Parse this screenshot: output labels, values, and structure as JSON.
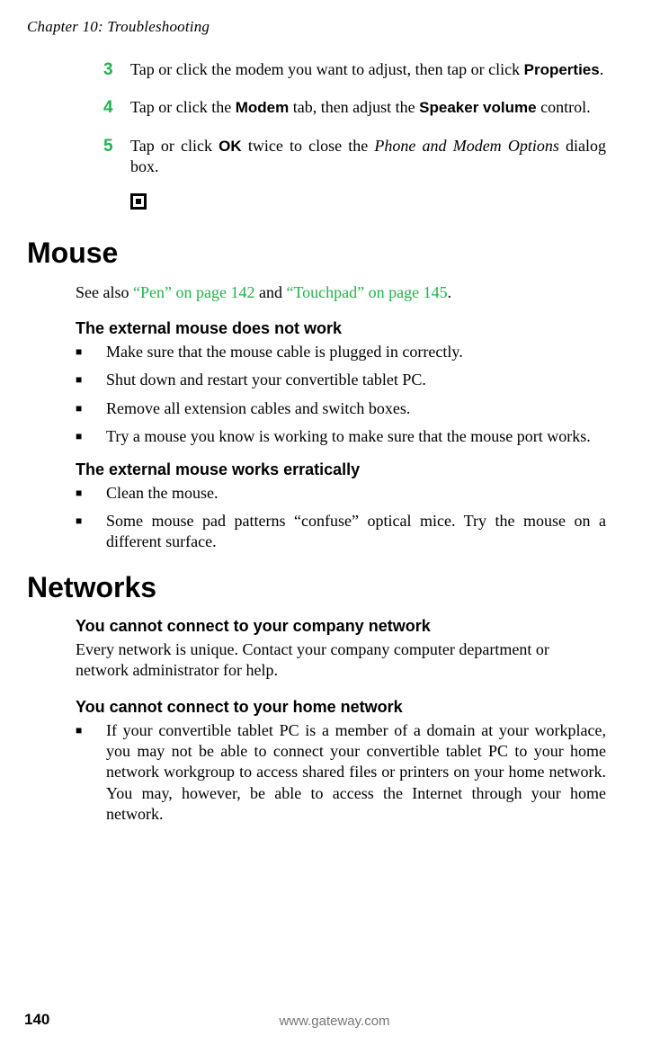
{
  "header": {
    "chapter": "Chapter 10: Troubleshooting"
  },
  "steps": [
    {
      "num": "3",
      "parts": [
        {
          "t": "Tap or click the modem you want to adjust, then tap or click "
        },
        {
          "t": "Properties",
          "cls": "bold-sans"
        },
        {
          "t": "."
        }
      ]
    },
    {
      "num": "4",
      "parts": [
        {
          "t": "Tap or click the "
        },
        {
          "t": "Modem",
          "cls": "bold-sans"
        },
        {
          "t": " tab, then adjust the "
        },
        {
          "t": "Speaker volume",
          "cls": "bold-sans"
        },
        {
          "t": " control."
        }
      ]
    },
    {
      "num": "5",
      "parts": [
        {
          "t": "Tap or click "
        },
        {
          "t": "OK",
          "cls": "bold-sans"
        },
        {
          "t": " twice to close the "
        },
        {
          "t": "Phone and Modem Options",
          "cls": "italic"
        },
        {
          "t": " dialog box."
        }
      ]
    }
  ],
  "mouse": {
    "title": "Mouse",
    "see_also_prefix": "See also ",
    "link1": "“Pen” on page 142",
    "and": " and ",
    "link2": "“Touchpad” on page 145",
    "period": ".",
    "sub1": "The external mouse does not work",
    "b1": "Make sure that the mouse cable is plugged in correctly.",
    "b2": "Shut down and restart your convertible tablet PC.",
    "b3": "Remove all extension cables and switch boxes.",
    "b4": "Try a mouse you know is working to make sure that the mouse port works.",
    "sub2": "The external mouse works erratically",
    "b5": "Clean the mouse.",
    "b6": "Some mouse pad patterns “confuse” optical mice. Try the mouse on a different surface."
  },
  "networks": {
    "title": "Networks",
    "sub1": "You cannot connect to your company network",
    "p1": "Every network is unique. Contact your company computer department or network administrator for help.",
    "sub2": "You cannot connect to your home network",
    "b1": "If your convertible tablet PC is a member of a domain at your workplace, you may not be able to connect your convertible tablet PC to your home network workgroup to access shared files or printers on your home network. You may, however, be able to access the Internet through your home network."
  },
  "footer": {
    "page": "140",
    "url": "www.gateway.com"
  }
}
